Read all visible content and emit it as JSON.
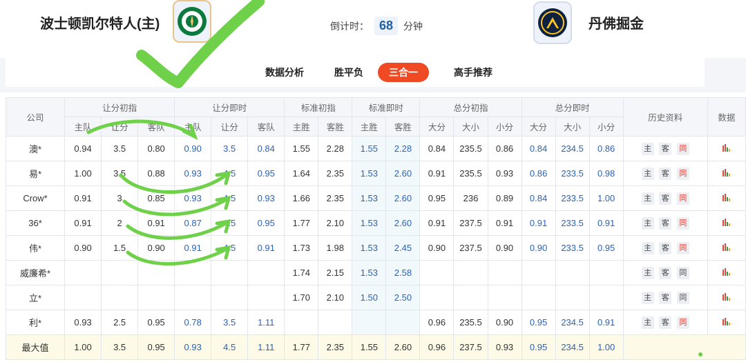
{
  "match": {
    "home_name": "波士顿凯尔特人(主)",
    "away_name": "丹佛掘金",
    "countdown_label": "倒计时：",
    "countdown_value": "68",
    "countdown_unit": "分钟"
  },
  "tabs": [
    {
      "label": "数据分析",
      "active": false
    },
    {
      "label": "胜平负",
      "active": false
    },
    {
      "label": "三合一",
      "active": true
    },
    {
      "label": "高手推荐",
      "active": false
    }
  ],
  "table": {
    "group_headers": {
      "company": "公司",
      "handicap_initial": "让分初指",
      "handicap_live": "让分即时",
      "standard_initial": "标准初指",
      "standard_live": "标准即时",
      "total_initial": "总分初指",
      "total_live": "总分即时",
      "history": "历史资料",
      "data": "数据"
    },
    "sub_headers": {
      "home_team": "主队",
      "handicap": "让分",
      "away_team": "客队",
      "home_win": "主胜",
      "away_win": "客胜",
      "big": "大分",
      "size": "大小",
      "small": "小分"
    },
    "history_buttons": [
      "主",
      "客",
      "同"
    ],
    "rows": [
      {
        "company": "澳*",
        "hi": [
          "0.94",
          "3.5",
          "0.80"
        ],
        "hl": [
          "0.90",
          "3.5",
          "0.84"
        ],
        "si": [
          "1.55",
          "2.28"
        ],
        "sl": [
          "1.55",
          "2.28"
        ],
        "ti": [
          "0.84",
          "235.5",
          "0.86"
        ],
        "tl": [
          "0.84",
          "234.5",
          "0.86"
        ],
        "same_red": true
      },
      {
        "company": "易*",
        "hi": [
          "1.00",
          "3.5",
          "0.88"
        ],
        "hl": [
          "0.93",
          "4.5",
          "0.95"
        ],
        "si": [
          "1.64",
          "2.35"
        ],
        "sl": [
          "1.53",
          "2.60"
        ],
        "ti": [
          "0.91",
          "235.5",
          "0.93"
        ],
        "tl": [
          "0.86",
          "233.5",
          "0.98"
        ],
        "same_red": true
      },
      {
        "company": "Crow*",
        "hi": [
          "0.91",
          "3",
          "0.85"
        ],
        "hl": [
          "0.93",
          "4.5",
          "0.93"
        ],
        "si": [
          "1.66",
          "2.35"
        ],
        "sl": [
          "1.53",
          "2.60"
        ],
        "ti": [
          "0.95",
          "236",
          "0.89"
        ],
        "tl": [
          "0.84",
          "233.5",
          "1.00"
        ],
        "same_red": true
      },
      {
        "company": "36*",
        "hi": [
          "0.91",
          "2",
          "0.91"
        ],
        "hl": [
          "0.87",
          "4.5",
          "0.95"
        ],
        "si": [
          "1.77",
          "2.10"
        ],
        "sl": [
          "1.53",
          "2.60"
        ],
        "ti": [
          "0.91",
          "237.5",
          "0.91"
        ],
        "tl": [
          "0.91",
          "233.5",
          "0.91"
        ],
        "same_red": true
      },
      {
        "company": "伟*",
        "hi": [
          "0.90",
          "1.5",
          "0.90"
        ],
        "hl": [
          "0.91",
          "4.5",
          "0.91"
        ],
        "si": [
          "1.73",
          "1.98"
        ],
        "sl": [
          "1.53",
          "2.45"
        ],
        "ti": [
          "0.90",
          "237.5",
          "0.90"
        ],
        "tl": [
          "0.90",
          "233.5",
          "0.95"
        ],
        "same_red": true
      },
      {
        "company": "威廉希*",
        "hi": [
          "",
          "",
          ""
        ],
        "hl": [
          "",
          "",
          ""
        ],
        "si": [
          "1.74",
          "2.15"
        ],
        "sl": [
          "1.53",
          "2.58"
        ],
        "ti": [
          "",
          "",
          ""
        ],
        "tl": [
          "",
          "",
          ""
        ],
        "same_red": false
      },
      {
        "company": "立*",
        "hi": [
          "",
          "",
          ""
        ],
        "hl": [
          "",
          "",
          ""
        ],
        "si": [
          "1.70",
          "2.10"
        ],
        "sl": [
          "1.50",
          "2.50"
        ],
        "ti": [
          "",
          "",
          ""
        ],
        "tl": [
          "",
          "",
          ""
        ],
        "same_red": false
      },
      {
        "company": "利*",
        "hi": [
          "0.93",
          "2.5",
          "0.95"
        ],
        "hl": [
          "0.78",
          "3.5",
          "1.11"
        ],
        "si": [
          "",
          ""
        ],
        "sl": [
          "",
          ""
        ],
        "ti": [
          "0.96",
          "235.5",
          "0.90"
        ],
        "tl": [
          "0.95",
          "234.5",
          "0.91"
        ],
        "same_red": true
      }
    ],
    "max_row": {
      "company": "最大值",
      "hi": [
        "1.00",
        "3.5",
        "0.95"
      ],
      "hl": [
        "0.93",
        "4.5",
        "1.11"
      ],
      "si": [
        "1.77",
        "2.35"
      ],
      "sl": [
        "1.55",
        "2.60"
      ],
      "ti": [
        "0.96",
        "237.5",
        "0.93"
      ],
      "tl": [
        "0.95",
        "234.5",
        "1.00"
      ]
    }
  },
  "colors": {
    "accent_tab": "#f04a24",
    "blue_value": "#2a62b8",
    "annotation_green": "#6fd14a"
  }
}
